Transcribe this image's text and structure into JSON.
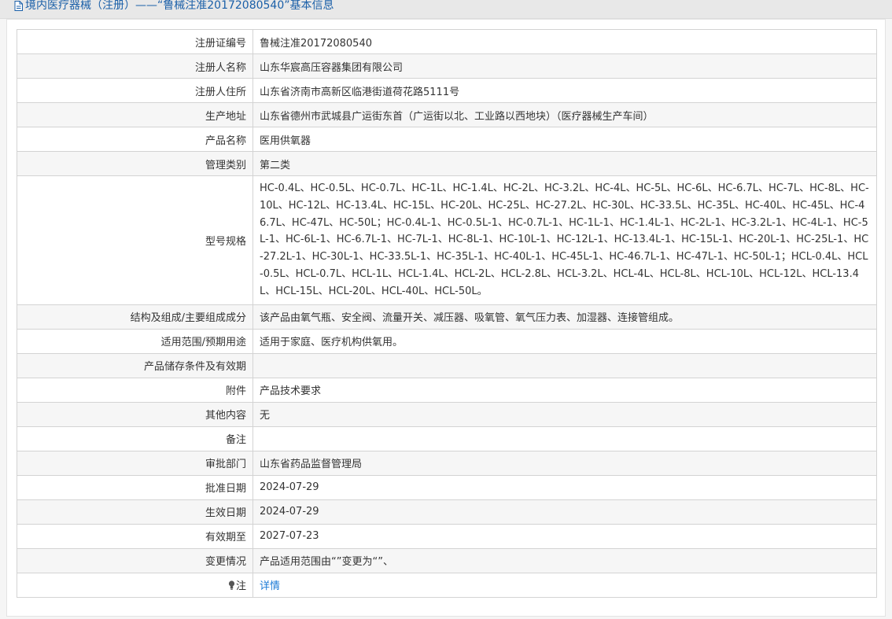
{
  "header": {
    "title": "境内医疗器械（注册）——“鲁械注准20172080540”基本信息"
  },
  "rows": [
    {
      "label": "注册证编号",
      "value": "鲁械注准20172080540"
    },
    {
      "label": "注册人名称",
      "value": "山东华宸高压容器集团有限公司"
    },
    {
      "label": "注册人住所",
      "value": "山东省济南市高新区临港街道荷花路5111号"
    },
    {
      "label": "生产地址",
      "value": "山东省德州市武城县广运街东首（广运街以北、工业路以西地块）（医疗器械生产车间）"
    },
    {
      "label": "产品名称",
      "value": "医用供氧器"
    },
    {
      "label": "管理类别",
      "value": "第二类"
    },
    {
      "label": "型号规格",
      "value": "HC-0.4L、HC-0.5L、HC-0.7L、HC-1L、HC-1.4L、HC-2L、HC-3.2L、HC-4L、HC-5L、HC-6L、HC-6.7L、HC-7L、HC-8L、HC-10L、HC-12L、HC-13.4L、HC-15L、HC-20L、HC-25L、HC-27.2L、HC-30L、HC-33.5L、HC-35L、HC-40L、HC-45L、HC-46.7L、HC-47L、HC-50L；HC-0.4L-1、HC-0.5L-1、HC-0.7L-1、HC-1L-1、HC-1.4L-1、HC-2L-1、HC-3.2L-1、HC-4L-1、HC-5L-1、HC-6L-1、HC-6.7L-1、HC-7L-1、HC-8L-1、HC-10L-1、HC-12L-1、HC-13.4L-1、HC-15L-1、HC-20L-1、HC-25L-1、HC-27.2L-1、HC-30L-1、HC-33.5L-1、HC-35L-1、HC-40L-1、HC-45L-1、HC-46.7L-1、HC-47L-1、HC-50L-1；HCL-0.4L、HCL-0.5L、HCL-0.7L、HCL-1L、HCL-1.4L、HCL-2L、HCL-2.8L、HCL-3.2L、HCL-4L、HCL-8L、HCL-10L、HCL-12L、HCL-13.4L、HCL-15L、HCL-20L、HCL-40L、HCL-50L。"
    },
    {
      "label": "结构及组成/主要组成成分",
      "value": "该产品由氧气瓶、安全阀、流量开关、减压器、吸氧管、氧气压力表、加湿器、连接管组成。"
    },
    {
      "label": "适用范围/预期用途",
      "value": "适用于家庭、医疗机构供氧用。"
    },
    {
      "label": "产品储存条件及有效期",
      "value": ""
    },
    {
      "label": "附件",
      "value": "产品技术要求"
    },
    {
      "label": "其他内容",
      "value": "无"
    },
    {
      "label": "备注",
      "value": ""
    },
    {
      "label": "审批部门",
      "value": "山东省药品监督管理局"
    },
    {
      "label": "批准日期",
      "value": "2024-07-29"
    },
    {
      "label": "生效日期",
      "value": "2024-07-29"
    },
    {
      "label": "有效期至",
      "value": "2027-07-23"
    },
    {
      "label": "变更情况",
      "value": "产品适用范围由“”变更为“”、"
    }
  ],
  "note": {
    "label": "注",
    "link": "详情"
  },
  "colors": {
    "title": "#1a5fa8",
    "link": "#1a7ad6",
    "border": "#d3d3d3",
    "stripe": "#f6f6f6"
  }
}
